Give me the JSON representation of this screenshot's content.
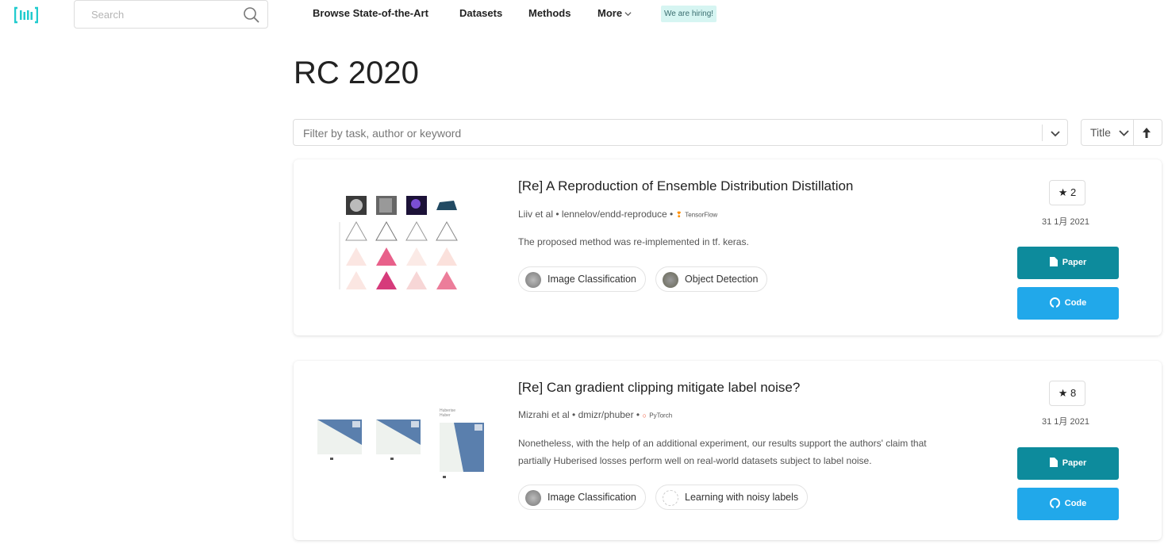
{
  "header": {
    "logo_icon": "paperswithcode-logo-icon",
    "search_placeholder": "Search",
    "nav": [
      "Browse State-of-the-Art",
      "Datasets",
      "Methods",
      "More"
    ],
    "hiring": "We are hiring!"
  },
  "page": {
    "title": "RC 2020"
  },
  "filter": {
    "placeholder": "Filter by task, author or keyword",
    "sort_label": "Title"
  },
  "papers": [
    {
      "title": "[Re] A Reproduction of Ensemble Distribution Distillation",
      "authors": "Liiv et al",
      "repo": "lennelov/endd-reproduce",
      "framework": "TensorFlow",
      "abstract": "The proposed method was re-implemented in tf. keras.",
      "tags": [
        "Image Classification",
        "Object Detection"
      ],
      "stars": "2",
      "date": "31 1月 2021",
      "paper_label": "Paper",
      "code_label": "Code"
    },
    {
      "title": "[Re] Can gradient clipping mitigate label noise?",
      "authors": "Mizrahi et al",
      "repo": "dmizr/phuber",
      "framework": "PyTorch",
      "abstract_lines": [
        "Nonetheless, with the help of an additional experiment, our results support the authors' claim that",
        "partially Huberised losses perform well on real-world datasets subject to label noise."
      ],
      "tags": [
        "Image Classification",
        "Learning with noisy labels"
      ],
      "stars": "8",
      "date": "31 1月 2021",
      "paper_label": "Paper",
      "code_label": "Code"
    }
  ],
  "colors": {
    "accent": "#21cbce",
    "paper_button": "#0d8b9c",
    "code_button": "#21a8ea",
    "hiring_bg": "#d6f5f2"
  }
}
